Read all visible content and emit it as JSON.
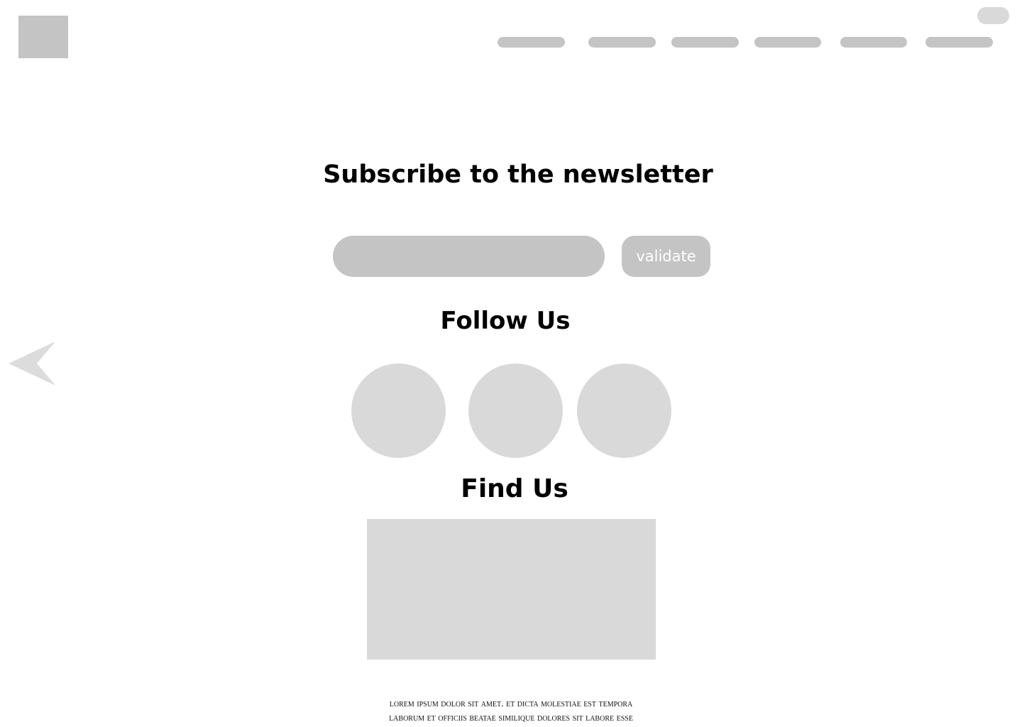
{
  "header": {
    "logo": "logo-placeholder",
    "nav_items": [
      "",
      "",
      "",
      "",
      "",
      ""
    ]
  },
  "newsletter": {
    "title": "Subscribe to the newsletter",
    "email_value": "",
    "email_placeholder": "",
    "validate_label": "validate"
  },
  "social": {
    "title": "Follow Us",
    "icons": [
      "social-icon-1",
      "social-icon-2",
      "social-icon-3"
    ]
  },
  "location": {
    "title": "Find Us",
    "map": "map-placeholder"
  },
  "footer": {
    "line1": "Lorem ipsum dolor sit amet. Et dicta molestiae est tempora",
    "line2": "laborum et officiis beatae  similique dolores sit labore esse"
  },
  "colors": {
    "placeholder_dark": "#c4c4c4",
    "placeholder_light": "#d9d9d9",
    "text": "#000000"
  }
}
